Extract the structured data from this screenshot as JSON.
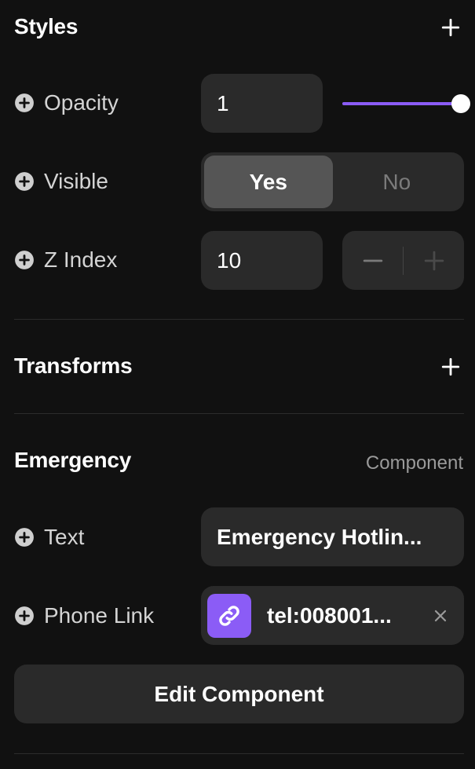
{
  "styles": {
    "title": "Styles",
    "opacity": {
      "label": "Opacity",
      "value": "1",
      "slider_fraction": 1.0
    },
    "visible": {
      "label": "Visible",
      "options": [
        "Yes",
        "No"
      ],
      "selected": "Yes"
    },
    "z_index": {
      "label": "Z Index",
      "value": "10"
    }
  },
  "transforms": {
    "title": "Transforms"
  },
  "emergency": {
    "title": "Emergency",
    "tag": "Component",
    "text": {
      "label": "Text",
      "value": "Emergency Hotlin..."
    },
    "phone_link": {
      "label": "Phone Link",
      "value": "tel:008001..."
    },
    "edit_button": "Edit Component"
  },
  "icons": {
    "add": "plus-icon",
    "row_add": "plus-circle-icon",
    "decrement": "minus-icon",
    "increment": "plus-icon",
    "link": "link-icon",
    "clear": "close-icon"
  },
  "colors": {
    "background": "#111111",
    "field": "#2a2a2a",
    "accent": "#8b5cf6",
    "segment_active": "#555555"
  }
}
